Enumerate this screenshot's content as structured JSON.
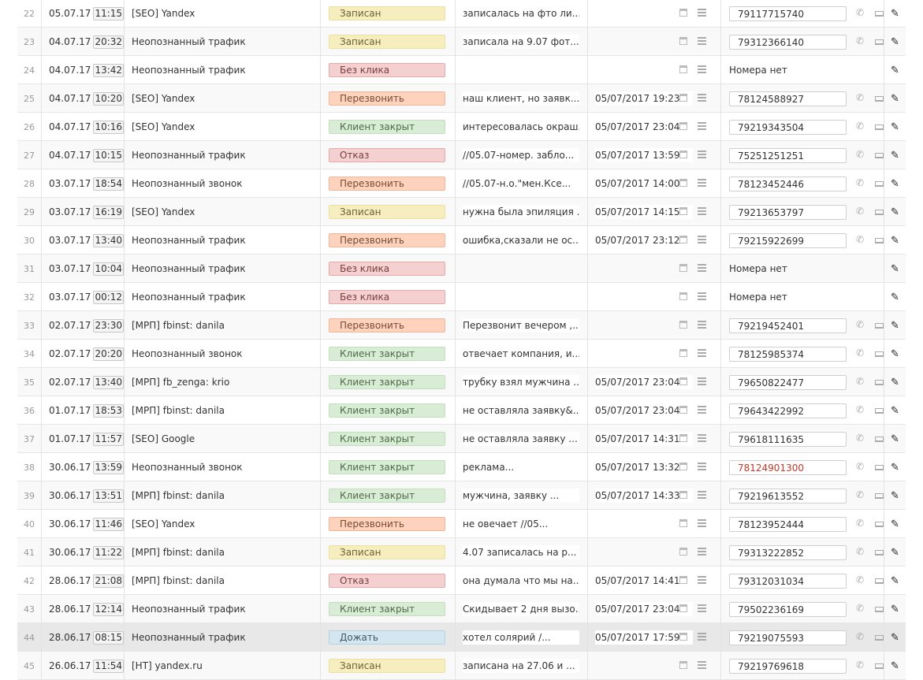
{
  "rows": [
    {
      "num": "22",
      "date": "05.07.17",
      "time": "11:15",
      "source": "[SEO] Yandex",
      "status": "Записан",
      "status_color": "yellow",
      "comment": "записалась на фто ли...",
      "recall": "",
      "recall_box": true,
      "phone": "79117715740"
    },
    {
      "num": "23",
      "date": "04.07.17",
      "time": "20:32",
      "source": "Неопознанный трафик",
      "status": "Записан",
      "status_color": "yellow",
      "comment": "записала на 9.07 фот...",
      "recall": "",
      "recall_box": false,
      "phone": "79312366140"
    },
    {
      "num": "24",
      "date": "04.07.17",
      "time": "13:42",
      "source": "Неопознанный трафик",
      "status": "Без клика",
      "status_color": "red",
      "comment": "",
      "recall": "",
      "recall_box": true,
      "phone": "",
      "no_phone": "Номера нет"
    },
    {
      "num": "25",
      "date": "04.07.17",
      "time": "10:20",
      "source": "[SEO] Yandex",
      "status": "Перезвонить",
      "status_color": "orange",
      "comment": "наш клиент, но заявк...",
      "recall": "05/07/2017 19:23",
      "recall_box": true,
      "phone": "78124588927"
    },
    {
      "num": "26",
      "date": "04.07.17",
      "time": "10:16",
      "source": "[SEO] Yandex",
      "status": "Клиент закрыт",
      "status_color": "green",
      "comment": "интересовалась окраш...",
      "recall": "05/07/2017 23:04",
      "recall_box": true,
      "phone": "79219343504"
    },
    {
      "num": "27",
      "date": "04.07.17",
      "time": "10:15",
      "source": "Неопознанный трафик",
      "status": "Отказ",
      "status_color": "red",
      "comment": "//05.07-номер. забло...",
      "recall": "05/07/2017 13:59",
      "recall_box": true,
      "phone": "75251251251"
    },
    {
      "num": "28",
      "date": "03.07.17",
      "time": "18:54",
      "source": "Неопознанный звонок",
      "status": "Перезвонить",
      "status_color": "orange",
      "comment": "//05.07-н.о.\"мен.Кce...",
      "recall": "05/07/2017 14:00",
      "recall_box": true,
      "phone": "78123452446"
    },
    {
      "num": "29",
      "date": "03.07.17",
      "time": "16:19",
      "source": "[SEO] Yandex",
      "status": "Записан",
      "status_color": "yellow",
      "comment": "нужна была эпиляция ...",
      "recall": "05/07/2017 14:15",
      "recall_box": true,
      "phone": "79213653797"
    },
    {
      "num": "30",
      "date": "03.07.17",
      "time": "13:40",
      "source": "Неопознанный трафик",
      "status": "Перезвонить",
      "status_color": "orange",
      "comment": "ошибка,сказали не ос...",
      "recall": "05/07/2017 23:12",
      "recall_box": true,
      "phone": "79215922699"
    },
    {
      "num": "31",
      "date": "03.07.17",
      "time": "10:04",
      "source": "Неопознанный трафик",
      "status": "Без клика",
      "status_color": "red",
      "comment": "",
      "recall": "",
      "recall_box": false,
      "phone": "",
      "no_phone": "Номера нет"
    },
    {
      "num": "32",
      "date": "03.07.17",
      "time": "00:12",
      "source": "Неопознанный трафик",
      "status": "Без клика",
      "status_color": "red",
      "comment": "",
      "recall": "",
      "recall_box": true,
      "phone": "",
      "no_phone": "Номера нет"
    },
    {
      "num": "33",
      "date": "02.07.17",
      "time": "23:30",
      "source": "[МРП] fbinst: danila",
      "status": "Перезвонить",
      "status_color": "orange",
      "comment": "Перезвонит вечером ,...",
      "recall": "",
      "recall_box": false,
      "phone": "79219452401"
    },
    {
      "num": "34",
      "date": "02.07.17",
      "time": "20:20",
      "source": "Неопознанный звонок",
      "status": "Клиент закрыт",
      "status_color": "green",
      "comment": "отвечает компания, и...",
      "recall": "",
      "recall_box": true,
      "phone": "78125985374"
    },
    {
      "num": "35",
      "date": "02.07.17",
      "time": "13:40",
      "source": "[МРП] fb_zenga: krio",
      "status": "Клиент закрыт",
      "status_color": "green",
      "comment": "трубку взял мужчина ...",
      "recall": "05/07/2017 23:04",
      "recall_box": false,
      "phone": "79650822477"
    },
    {
      "num": "36",
      "date": "01.07.17",
      "time": "18:53",
      "source": "[МРП] fbinst: danila",
      "status": "Клиент закрыт",
      "status_color": "green",
      "comment": "не оставляла заявку&...",
      "recall": "05/07/2017 23:04",
      "recall_box": true,
      "phone": "79643422992"
    },
    {
      "num": "37",
      "date": "01.07.17",
      "time": "11:57",
      "source": "[SEO] Google",
      "status": "Клиент закрыт",
      "status_color": "green",
      "comment": "не оставляла заявку ...",
      "recall": "05/07/2017 14:31",
      "recall_box": false,
      "phone": "79618111635"
    },
    {
      "num": "38",
      "date": "30.06.17",
      "time": "13:59",
      "source": "Неопознанный звонок",
      "status": "Клиент закрыт",
      "status_color": "green",
      "comment": "реклама...",
      "recall": "05/07/2017 13:32",
      "recall_box": true,
      "phone": "78124901300",
      "phone_red": true
    },
    {
      "num": "39",
      "date": "30.06.17",
      "time": "13:51",
      "source": "[МРП] fbinst: danila",
      "status": "Клиент закрыт",
      "status_color": "green",
      "comment": "мужчина, заявку ...",
      "recall": "05/07/2017 14:33",
      "recall_box": false,
      "phone": "79219613552"
    },
    {
      "num": "40",
      "date": "30.06.17",
      "time": "11:46",
      "source": "[SEO] Yandex",
      "status": "Перезвонить",
      "status_color": "orange",
      "comment": "не овечает //05...",
      "recall": "",
      "recall_box": true,
      "phone": "78123952444"
    },
    {
      "num": "41",
      "date": "30.06.17",
      "time": "11:22",
      "source": "[МРП] fbinst: danila",
      "status": "Записан",
      "status_color": "yellow",
      "comment": "4.07 записалась на р...",
      "recall": "",
      "recall_box": false,
      "phone": "79313222852"
    },
    {
      "num": "42",
      "date": "28.06.17",
      "time": "21:08",
      "source": "[МРП] fbinst: danila",
      "status": "Отказ",
      "status_color": "red",
      "comment": "она думала что мы на...",
      "recall": "05/07/2017 14:41",
      "recall_box": true,
      "phone": "79312031034"
    },
    {
      "num": "43",
      "date": "28.06.17",
      "time": "12:14",
      "source": "Неопознанный трафик",
      "status": "Клиент закрыт",
      "status_color": "green",
      "comment": "Скидывает 2 дня вызо...",
      "recall": "05/07/2017 23:04",
      "recall_box": false,
      "phone": "79502236169"
    },
    {
      "num": "44",
      "date": "28.06.17",
      "time": "08:15",
      "source": "Неопознанный трафик",
      "status": "Дожать",
      "status_color": "blue",
      "comment": "хотел солярий /...",
      "recall": "05/07/2017 17:59",
      "recall_box": true,
      "phone": "79219075593",
      "highlight": true
    },
    {
      "num": "45",
      "date": "26.06.17",
      "time": "11:54",
      "source": "[НТ] yandex.ru",
      "status": "Записан",
      "status_color": "yellow",
      "comment": "записана на 27.06 и ...",
      "recall": "",
      "recall_box": false,
      "phone": "79219769618"
    }
  ]
}
